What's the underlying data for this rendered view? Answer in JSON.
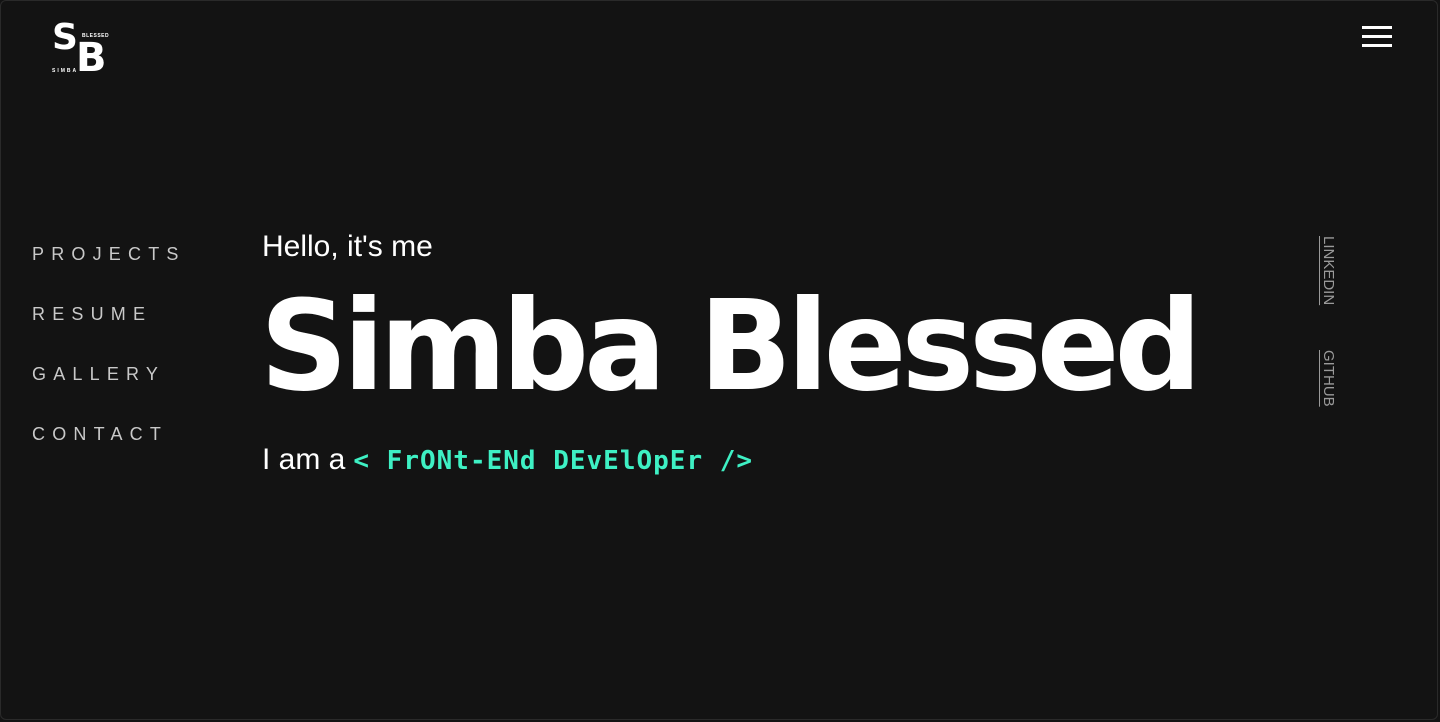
{
  "logo": {
    "initial_s": "S",
    "initial_b": "B",
    "word_top": "BLESSED",
    "word_bottom": "SIMBA"
  },
  "menu": {
    "icon": "hamburger-menu-icon"
  },
  "nav": {
    "items": [
      {
        "label": "PROJECTS"
      },
      {
        "label": "RESUME"
      },
      {
        "label": "GALLERY"
      },
      {
        "label": "CONTACT"
      }
    ]
  },
  "hero": {
    "greeting": "Hello, it's me",
    "name": "Simba Blessed",
    "tagline_prefix": "I am a",
    "tagline_role": "< FrONt-ENd DEvElOpEr />"
  },
  "social": {
    "linkedin": "LINKEDIN",
    "github": "GITHUB"
  },
  "colors": {
    "background": "#131313",
    "text": "#ffffff",
    "nav_text": "#c9c9c9",
    "accent": "#3ef0c4",
    "social_text": "#9a9a9a"
  }
}
